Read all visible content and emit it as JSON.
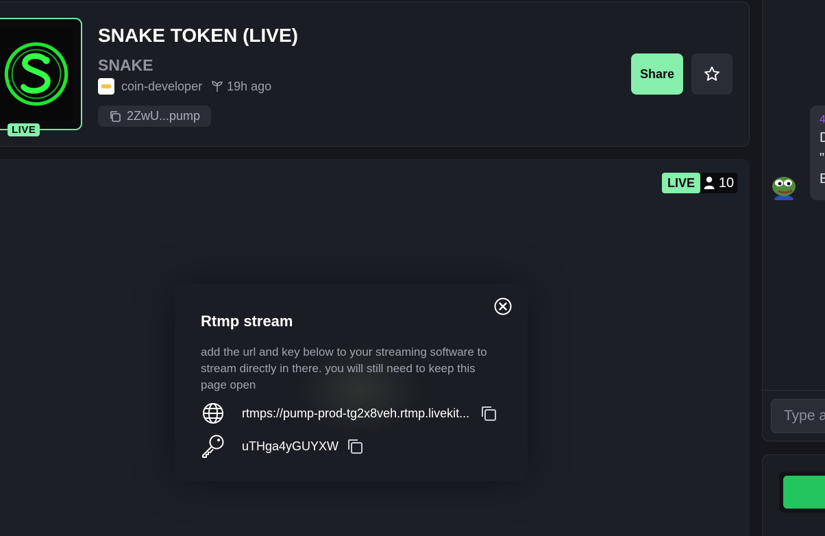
{
  "token": {
    "name": "SNAKE TOKEN (LIVE)",
    "ticker": "SNAKE",
    "creator": "coin-developer",
    "age": "19h ago",
    "contract_short": "2ZwU...pump",
    "logo_live_label": "LIVE"
  },
  "actions": {
    "share_label": "Share",
    "favorite_icon": "star-icon"
  },
  "stream": {
    "live_label": "LIVE",
    "viewer_count": "10"
  },
  "rtmp_modal": {
    "title": "Rtmp stream",
    "description": "add the url and key below to your streaming software to stream directly in there. you will still need to keep this page open",
    "url": "rtmps://pump-prod-tg2x8veh.rtmp.livekit...",
    "key": "uTHga4yGUYXW"
  },
  "chat": {
    "message_user": "4",
    "message_lines": [
      "D",
      "\"",
      "B"
    ],
    "input_placeholder": "Type a"
  },
  "colors": {
    "accent_green": "#86efac",
    "buy_green": "#22c55e",
    "background": "#15171d",
    "card": "#1b1d24"
  }
}
